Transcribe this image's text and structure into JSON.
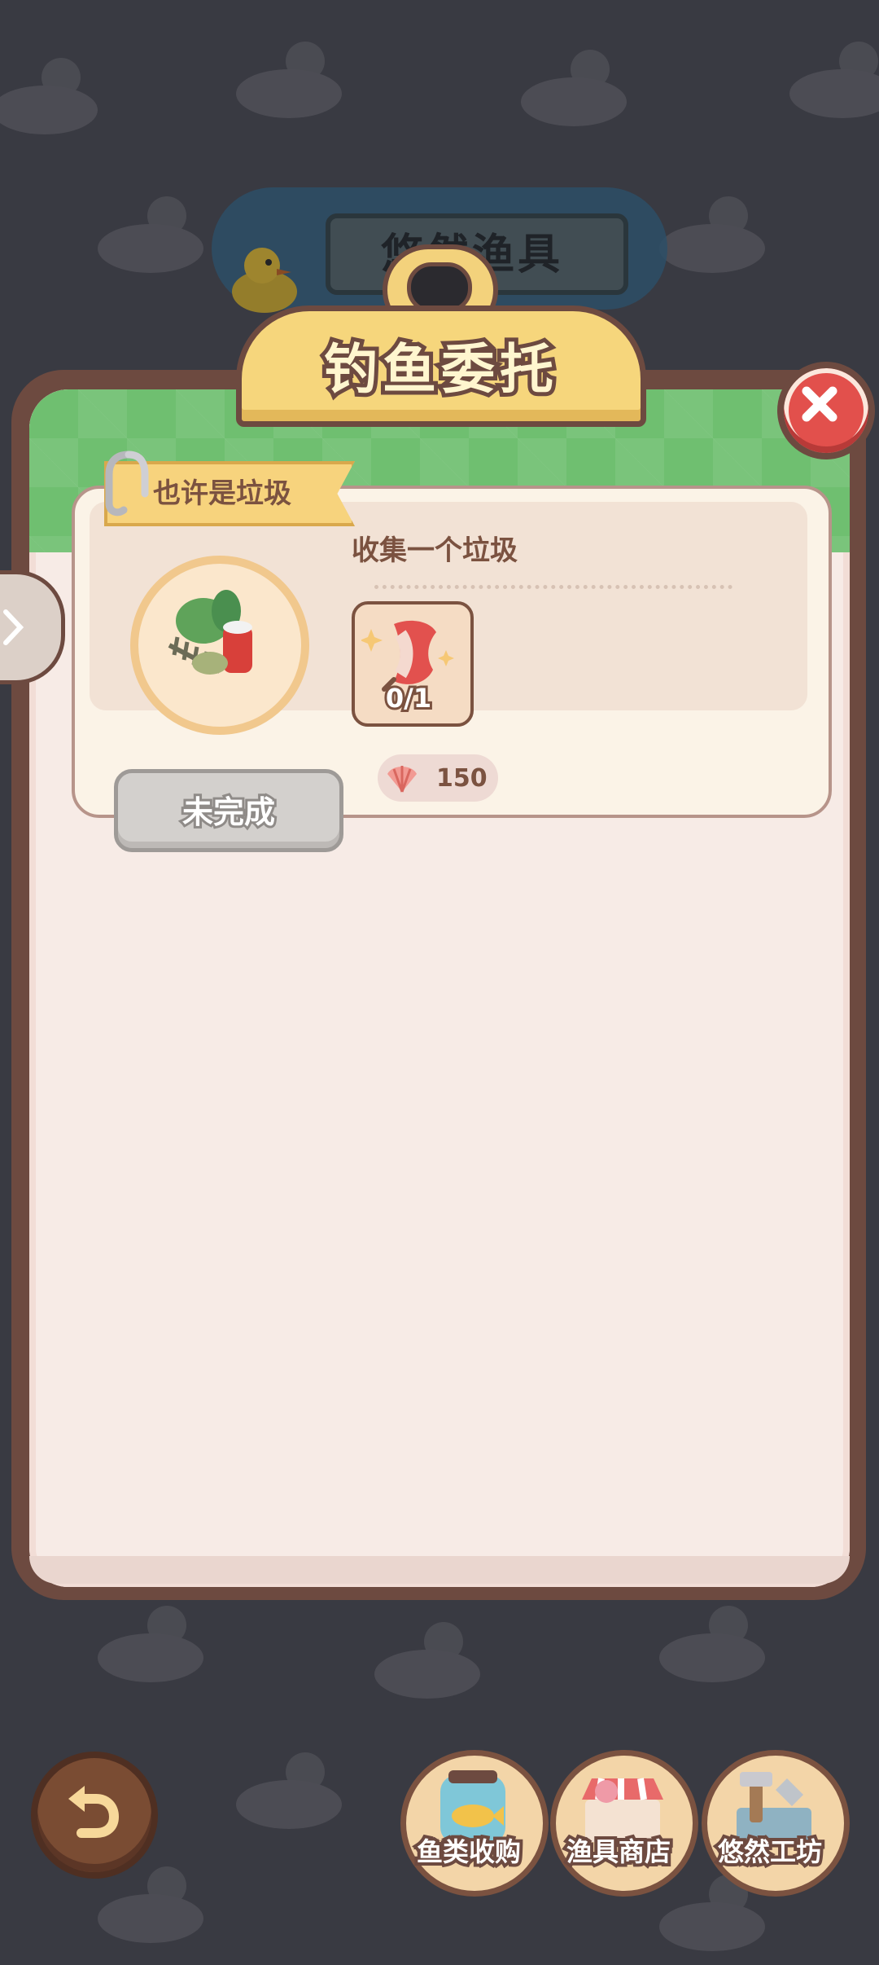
{
  "background_scene": {
    "banner_title": "悠然渔具"
  },
  "dialog": {
    "title": "钓鱼委托"
  },
  "task": {
    "tag": "也许是垃圾",
    "description": "收集一个垃圾",
    "requirement": {
      "item_icon": "apple-core-icon",
      "progress": "0/1"
    },
    "reward": {
      "icon": "shell-icon",
      "amount": "150"
    },
    "status": "未完成"
  },
  "bottom_nav": [
    {
      "label": "鱼类收购",
      "icon": "fish-jar-icon"
    },
    {
      "label": "渔具商店",
      "icon": "shop-stall-icon"
    },
    {
      "label": "悠然工坊",
      "icon": "workshop-tools-icon"
    }
  ],
  "colors": {
    "accent": "#6d4a40",
    "panel": "#f7ebe6",
    "header_green": "#6fbf70",
    "close": "#e2504c"
  }
}
